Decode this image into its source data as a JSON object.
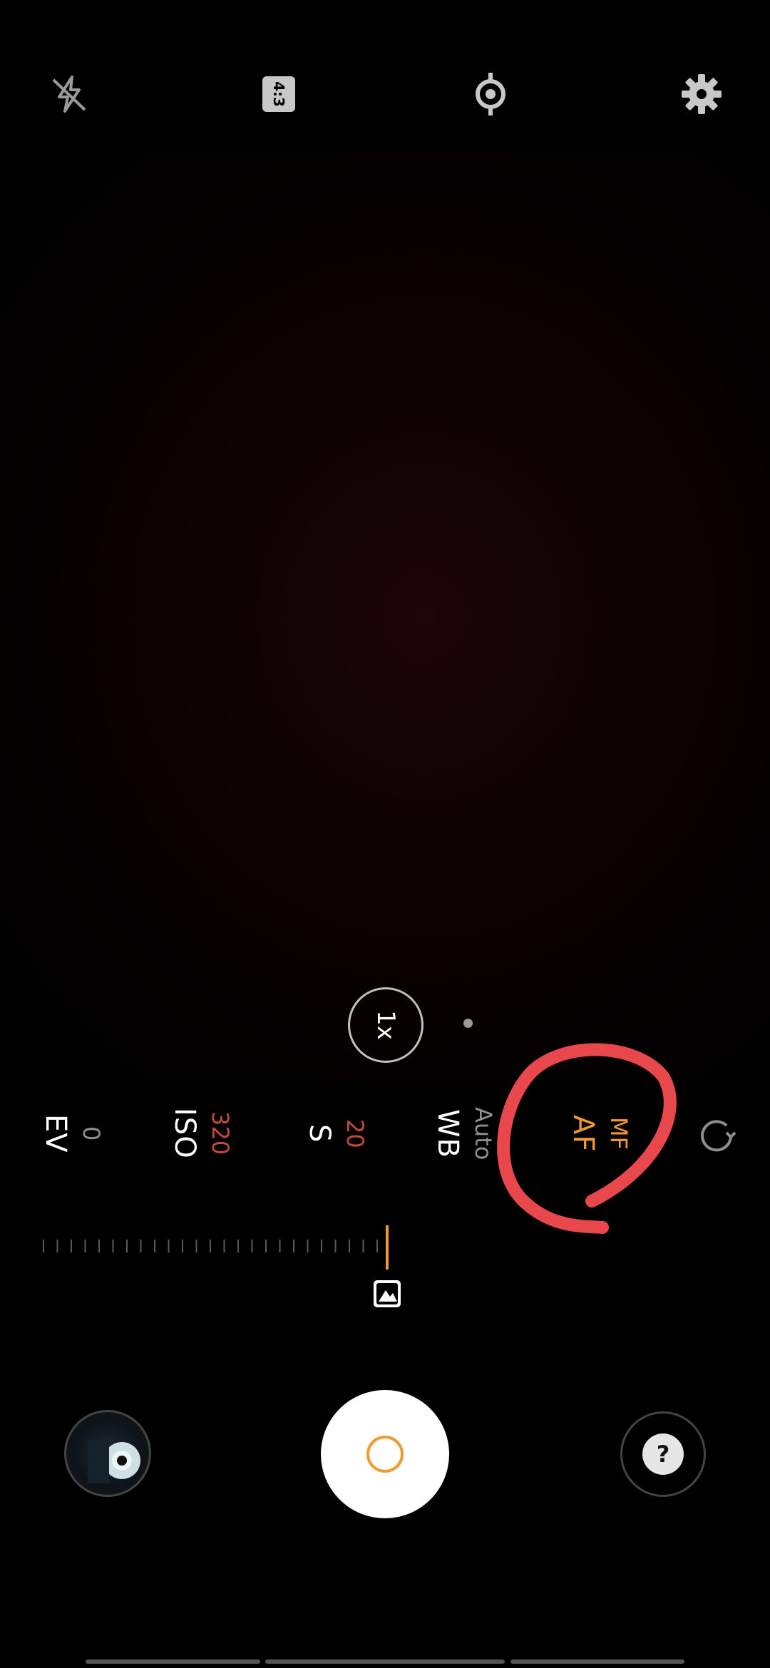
{
  "topbar": {
    "flash_icon": "flash-off-icon",
    "aspect_ratio_label": "4:3",
    "focus_icon": "focus-target-icon",
    "settings_icon": "gear-icon"
  },
  "zoom": {
    "label": "1x"
  },
  "params": {
    "ev": {
      "label": "EV",
      "value": "0"
    },
    "iso": {
      "label": "ISO",
      "value": "320"
    },
    "shutter": {
      "label": "S",
      "value": "20"
    },
    "wb": {
      "label": "WB",
      "value": "Auto"
    },
    "focus": {
      "label": "AF",
      "value": "MF"
    }
  },
  "colors": {
    "accent_orange": "#f29a2e",
    "value_red": "#c4493d",
    "value_gray": "#8e8e8e",
    "annotation_red": "#e8474c"
  },
  "slider": {
    "icon": "landscape-focus-icon",
    "level": 1.0
  },
  "bottom": {
    "gallery_icon": "gallery-thumbnail",
    "shutter_icon": "shutter-button",
    "mode_icon": "question-mode-icon"
  }
}
